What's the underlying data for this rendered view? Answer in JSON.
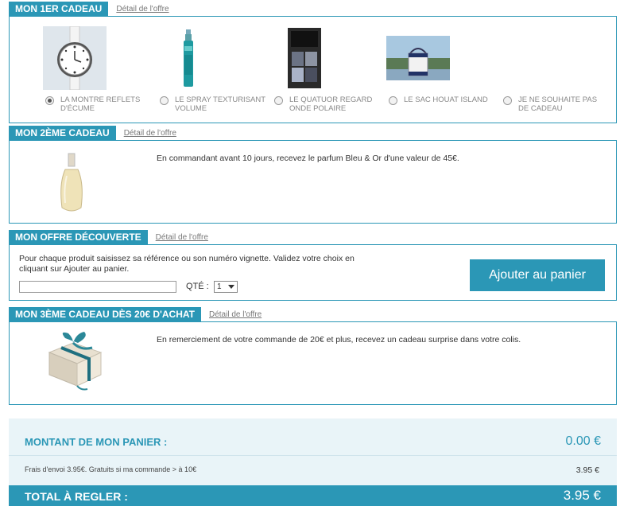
{
  "gift1": {
    "title": "MON 1ER CADEAU",
    "detail_link": "Détail de l'offre",
    "options": [
      {
        "label": "LA MONTRE REFLETS D'ÉCUME",
        "selected": true,
        "icon": "watch-image"
      },
      {
        "label": "LE SPRAY TEXTURISANT VOLUME",
        "selected": false,
        "icon": "spray-image"
      },
      {
        "label": "LE QUATUOR REGARD ONDE POLAIRE",
        "selected": false,
        "icon": "eyeshadow-palette-image"
      },
      {
        "label": "LE SAC HOUAT ISLAND",
        "selected": false,
        "icon": "bag-image"
      },
      {
        "label": "JE NE SOUHAITE PAS DE CADEAU",
        "selected": false,
        "icon": ""
      }
    ]
  },
  "gift2": {
    "title": "MON 2ÈME CADEAU",
    "detail_link": "Détail de l'offre",
    "text": "En commandant avant 10 jours, recevez le parfum Bleu & Or d'une valeur de 45€."
  },
  "discovery": {
    "title": "MON OFFRE DÉCOUVERTE",
    "detail_link": "Détail de l'offre",
    "description": "Pour chaque produit saisissez sa référence ou son numéro vignette. Validez votre choix en cliquant sur Ajouter au panier.",
    "reference_value": "",
    "qty_label": "QTÉ :",
    "qty_value": "1",
    "add_button": "Ajouter au panier"
  },
  "gift3": {
    "title": "MON 3ÈME CADEAU DÈS 20€ D'ACHAT",
    "detail_link": "Détail de l'offre",
    "text": "En remerciement de votre commande de 20€ et plus, recevez un cadeau surprise dans votre colis."
  },
  "totals": {
    "cart_label": "MONTANT DE MON PANIER :",
    "cart_value": "0.00 €",
    "shipping_label": "Frais d'envoi 3.95€. Gratuits si ma commande > à 10€",
    "shipping_value": "3.95 €",
    "total_label": "TOTAL À REGLER :",
    "total_value": "3.95 €"
  },
  "colors": {
    "accent": "#2b97b6",
    "totals_bg": "#e9f4f8"
  }
}
